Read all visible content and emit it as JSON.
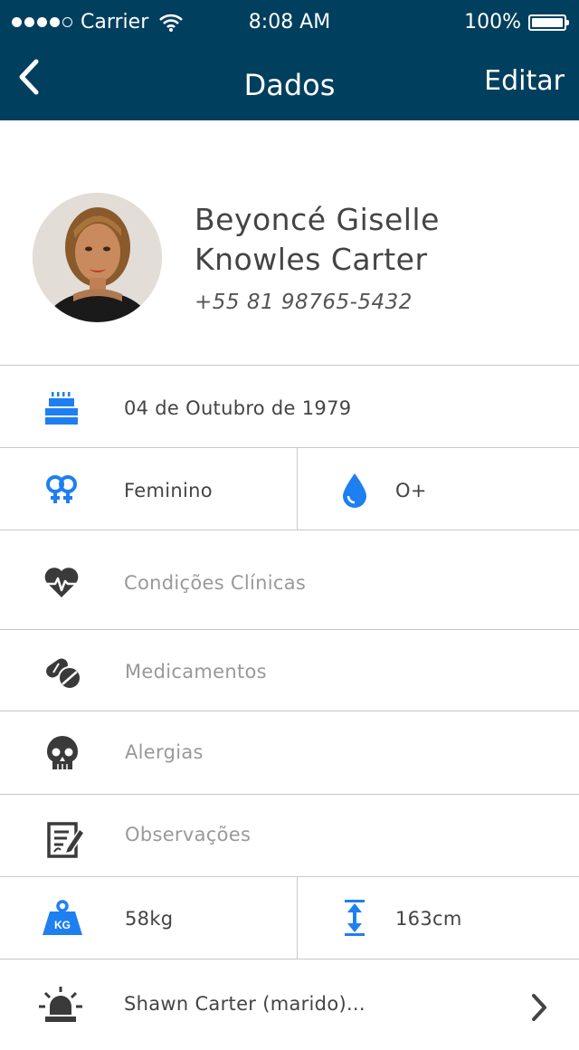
{
  "status_bar": {
    "carrier": "Carrier",
    "time": "8:08 AM",
    "battery": "100%"
  },
  "nav": {
    "title": "Dados",
    "edit_label": "Editar"
  },
  "profile": {
    "name_line1": "Beyoncé Giselle",
    "name_line2": "Knowles Carter",
    "phone": "+55 81 98765-5432"
  },
  "info": {
    "birthday": "04 de Outubro de 1979",
    "gender": "Feminino",
    "blood_type": "O+",
    "clinical_conditions": "Condições Clínicas",
    "medications": "Medicamentos",
    "allergies": "Alergias",
    "notes": "Observações",
    "weight": "58kg",
    "weight_badge": "KG",
    "height": "163cm",
    "emergency_contact": "Shawn Carter (marido)..."
  },
  "colors": {
    "header_bg": "#003f5e",
    "accent_blue": "#1e7ff0",
    "icon_dark": "#3a3a3a"
  }
}
